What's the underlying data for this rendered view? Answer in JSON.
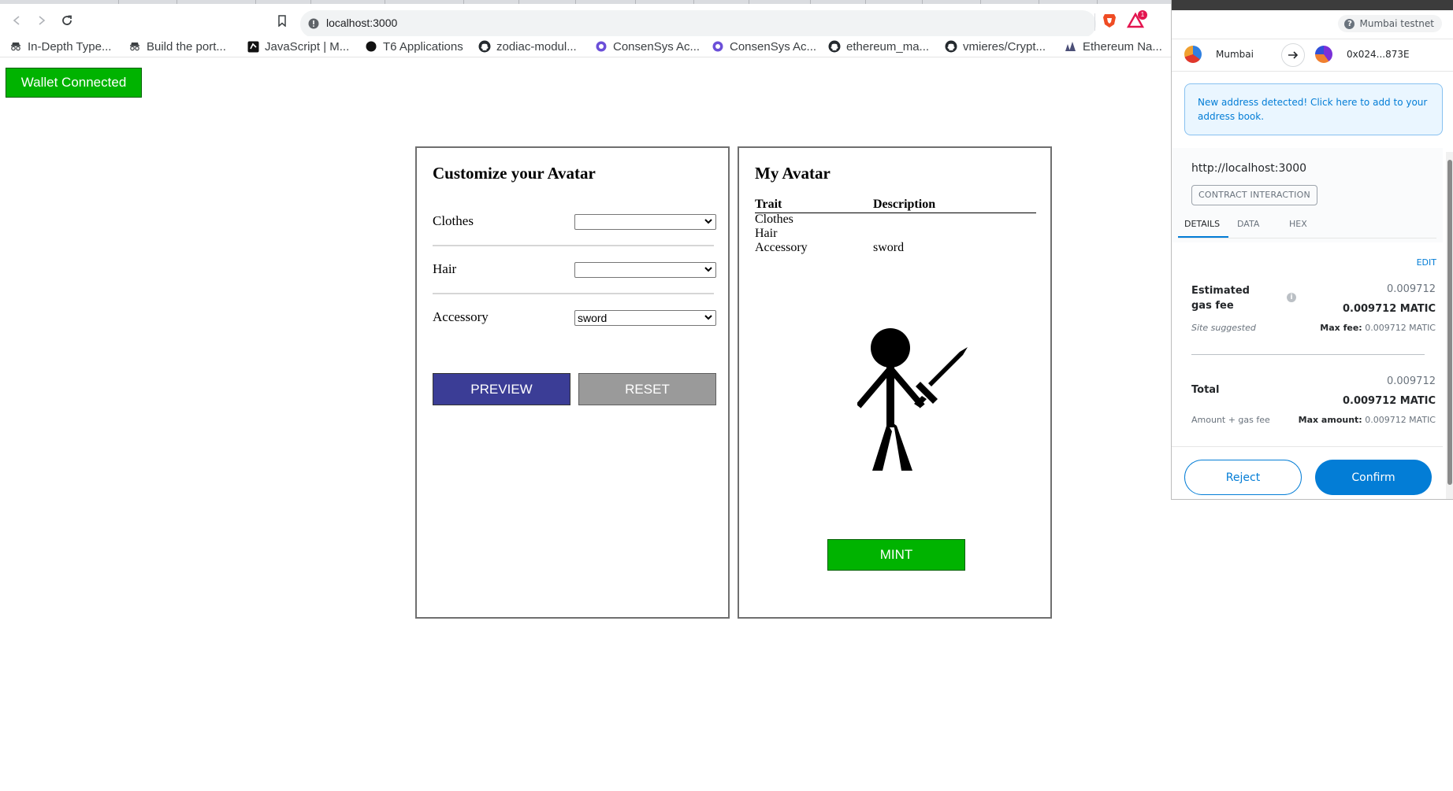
{
  "browser": {
    "url": "localhost:3000",
    "bookmarks": [
      {
        "label": "In-Depth Type...",
        "icon": "incognito-glasses-icon"
      },
      {
        "label": "Build the port...",
        "icon": "incognito-glasses-icon"
      },
      {
        "label": "JavaScript | M...",
        "icon": "site-favicon-icon"
      },
      {
        "label": "T6 Applications",
        "icon": "black-circle-icon"
      },
      {
        "label": "zodiac-modul...",
        "icon": "github-icon"
      },
      {
        "label": "ConsenSys Ac...",
        "icon": "consensys-icon"
      },
      {
        "label": "ConsenSys Ac...",
        "icon": "consensys-icon"
      },
      {
        "label": "ethereum_ma...",
        "icon": "github-icon"
      },
      {
        "label": "vmieres/Crypt...",
        "icon": "github-icon"
      },
      {
        "label": "Ethereum Na...",
        "icon": "ethereum-name-icon"
      }
    ],
    "extension_badge": "1"
  },
  "page": {
    "wallet_button": "Wallet Connected",
    "customize": {
      "title": "Customize your Avatar",
      "rows": [
        {
          "label": "Clothes",
          "value": ""
        },
        {
          "label": "Hair",
          "value": ""
        },
        {
          "label": "Accessory",
          "value": "sword"
        }
      ],
      "preview_button": "PREVIEW",
      "reset_button": "RESET"
    },
    "avatar": {
      "title": "My Avatar",
      "col_trait": "Trait",
      "col_description": "Description",
      "traits": [
        {
          "trait": "Clothes",
          "description": ""
        },
        {
          "trait": "Hair",
          "description": ""
        },
        {
          "trait": "Accessory",
          "description": "sword"
        }
      ],
      "mint_button": "MINT"
    }
  },
  "metamask": {
    "network": "Mumbai testnet",
    "from_account": "Mumbai",
    "to_account": "0x024...873E",
    "notice": "New address detected! Click here to add to your address book.",
    "origin": "http://localhost:3000",
    "badge": "CONTRACT INTERACTION",
    "tabs": [
      "DETAILS",
      "DATA",
      "HEX"
    ],
    "edit": "EDIT",
    "gas": {
      "label": "Estimated gas fee",
      "value_small": "0.009712",
      "value_main": "0.009712 MATIC",
      "sub_left": "Site suggested",
      "sub_right_label": "Max fee:",
      "sub_right_value": "0.009712 MATIC"
    },
    "total": {
      "label": "Total",
      "value_small": "0.009712",
      "value_main": "0.009712 MATIC",
      "sub_left": "Amount + gas fee",
      "sub_right_label": "Max amount:",
      "sub_right_value": "0.009712 MATIC"
    },
    "reject": "Reject",
    "confirm": "Confirm"
  }
}
